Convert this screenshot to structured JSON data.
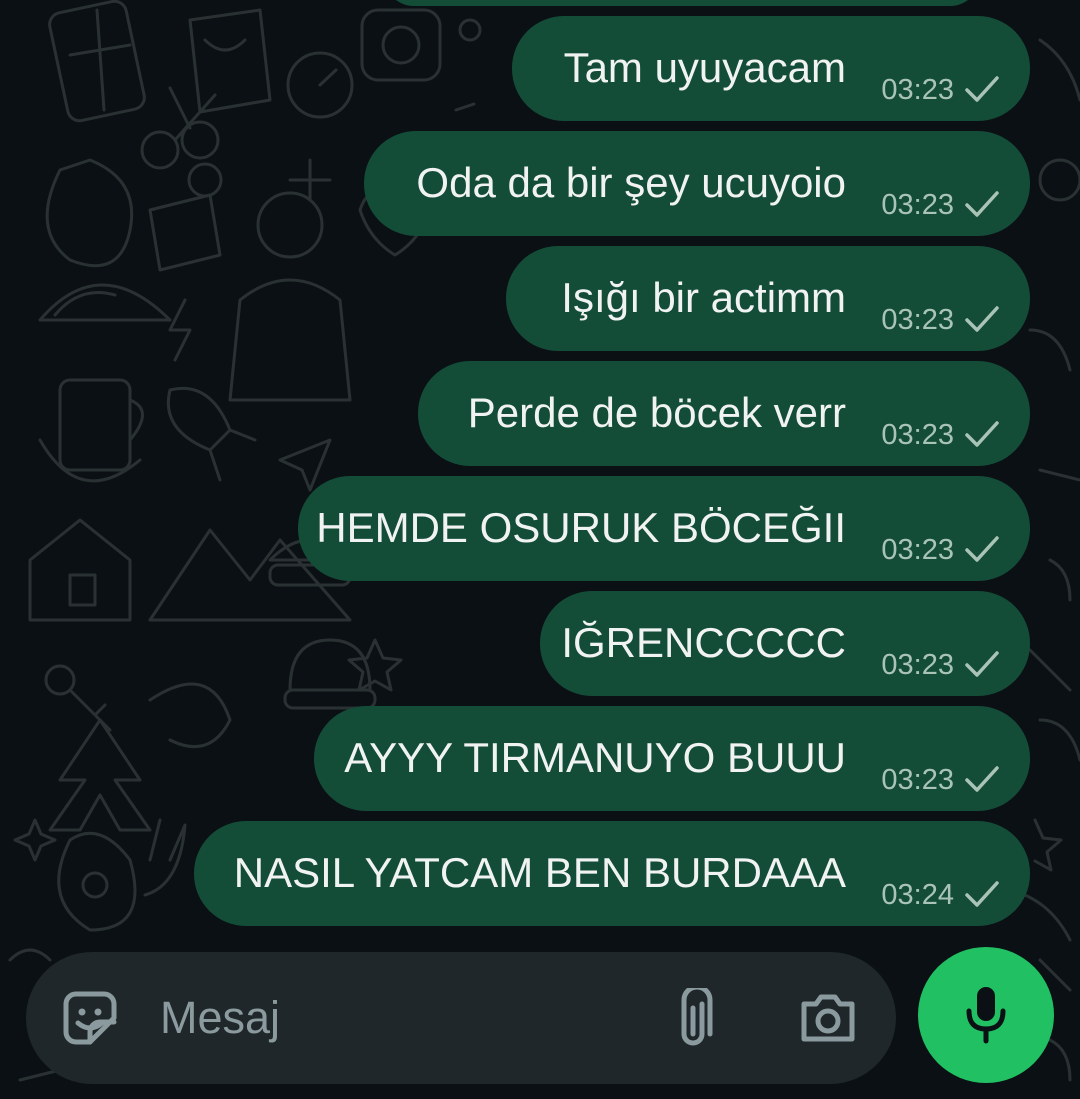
{
  "colors": {
    "background": "#0b1014",
    "bubble_outgoing": "#144d37",
    "bubble_text": "#f1f3f2",
    "time_text": "#a9c4b7",
    "input_bar": "#1f272a",
    "mic_button": "#21c063"
  },
  "messages": [
    {
      "text": "Tam uyuyacam",
      "time": "03:23",
      "status": "sent-tick"
    },
    {
      "text": "Oda da bir şey ucuyoio",
      "time": "03:23",
      "status": "sent-tick"
    },
    {
      "text": "Işığı bir actimm",
      "time": "03:23",
      "status": "sent-tick"
    },
    {
      "text": "Perde de böcek verr",
      "time": "03:23",
      "status": "sent-tick"
    },
    {
      "text": "HEMDE OSURUK BÖCEĞII",
      "time": "03:23",
      "status": "sent-tick"
    },
    {
      "text": "IĞRENCCCCC",
      "time": "03:23",
      "status": "sent-tick"
    },
    {
      "text": "AYYY TIRMANUYO BUUU",
      "time": "03:23",
      "status": "sent-tick"
    },
    {
      "text": "NASIL YATCAM BEN BURDAAA",
      "time": "03:24",
      "status": "sent-tick"
    }
  ],
  "composer": {
    "placeholder": "Mesaj",
    "icons": [
      "sticker-icon",
      "paperclip-icon",
      "camera-icon",
      "microphone-icon"
    ]
  }
}
